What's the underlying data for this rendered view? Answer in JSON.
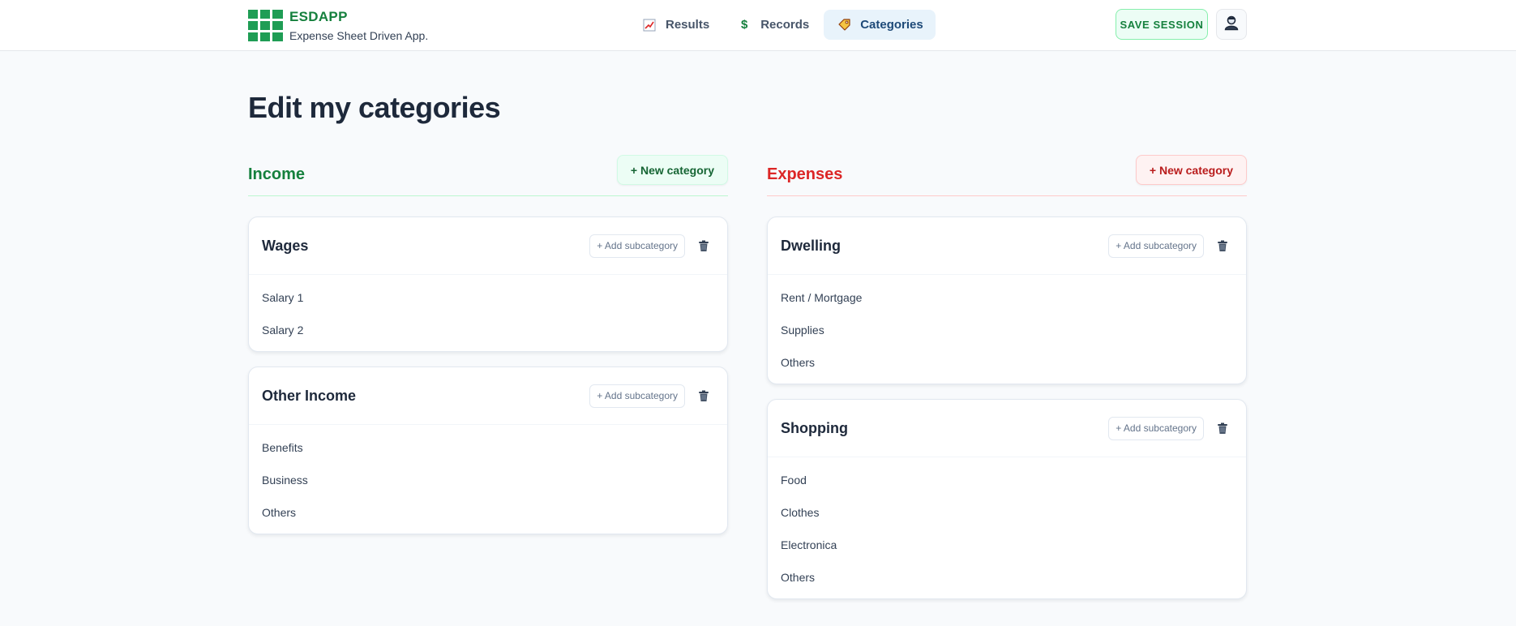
{
  "brand": {
    "name": "ESDAPP",
    "subtitle": "Expense Sheet Driven App."
  },
  "nav": [
    {
      "label": "Results",
      "icon": "chart-icon"
    },
    {
      "label": "Records",
      "icon": "dollar-icon"
    },
    {
      "label": "Categories",
      "icon": "tag-icon",
      "active": true
    }
  ],
  "save_label": "SAVE SESSION",
  "page_title": "Edit my categories",
  "income": {
    "title": "Income",
    "new_label": "+ New category",
    "categories": [
      {
        "name": "Wages",
        "add_label": "+ Add subcategory",
        "subs": [
          "Salary 1",
          "Salary 2"
        ]
      },
      {
        "name": "Other Income",
        "add_label": "+ Add subcategory",
        "subs": [
          "Benefits",
          "Business",
          "Others"
        ]
      }
    ]
  },
  "expenses": {
    "title": "Expenses",
    "new_label": "+ New category",
    "categories": [
      {
        "name": "Dwelling",
        "add_label": "+ Add subcategory",
        "subs": [
          "Rent / Mortgage",
          "Supplies",
          "Others"
        ]
      },
      {
        "name": "Shopping",
        "add_label": "+ Add subcategory",
        "subs": [
          "Food",
          "Clothes",
          "Electronica",
          "Others"
        ]
      }
    ]
  },
  "colors": {
    "income": "#15803d",
    "expenses": "#dc2626",
    "active_nav_bg": "#e8f3fb"
  }
}
